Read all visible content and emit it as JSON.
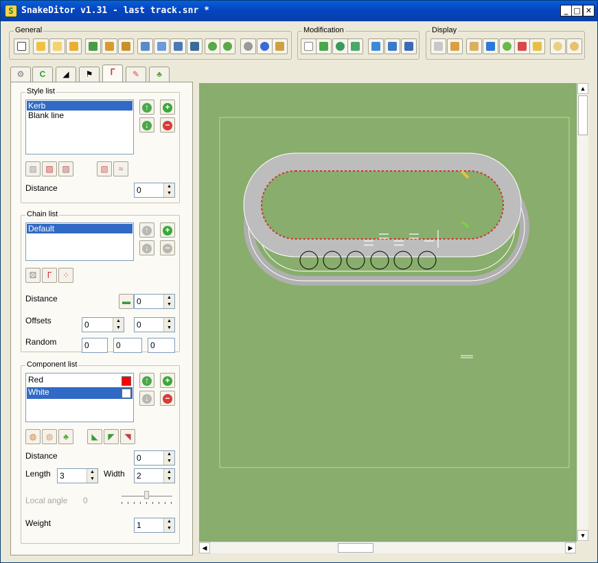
{
  "window": {
    "title": "SnakeDitor v1.31 - last track.snr *"
  },
  "titlebar_buttons": {
    "minimize": "_",
    "maximize": "□",
    "close": "✕"
  },
  "toolbar": {
    "general_label": "General",
    "modification_label": "Modification",
    "display_label": "Display"
  },
  "tabs": [
    {
      "icon": "gear-icon"
    },
    {
      "icon": "green-curve-icon"
    },
    {
      "icon": "slope-icon"
    },
    {
      "icon": "checkered-flag-icon"
    },
    {
      "icon": "kerb-icon"
    },
    {
      "icon": "brush-icon"
    },
    {
      "icon": "tree-icon"
    }
  ],
  "style_list": {
    "label": "Style list",
    "items": [
      "Kerb",
      "Blank line"
    ],
    "selected": 0,
    "distance_label": "Distance",
    "distance_value": "0"
  },
  "chain_list": {
    "label": "Chain list",
    "items": [
      "Default"
    ],
    "selected": 0,
    "distance_label": "Distance",
    "distance_value": "0",
    "offsets_label": "Offsets",
    "offset1": "0",
    "offset2": "0",
    "random_label": "Random",
    "random1": "0",
    "random2": "0",
    "random3": "0"
  },
  "component_list": {
    "label": "Component list",
    "items": [
      {
        "name": "Red",
        "color": "#ff0000"
      },
      {
        "name": "White",
        "color": "#ffffff"
      }
    ],
    "selected": 1,
    "distance_label": "Distance",
    "distance_value": "0",
    "length_label": "Length",
    "length_value": "3",
    "width_label": "Width",
    "width_value": "2",
    "local_angle_label": "Local angle",
    "local_angle_value": "0",
    "weight_label": "Weight",
    "weight_value": "1"
  },
  "colors": {
    "grass": "#88ad6c",
    "selection": "#316ac5",
    "titlebar": "#0a5fd8"
  }
}
